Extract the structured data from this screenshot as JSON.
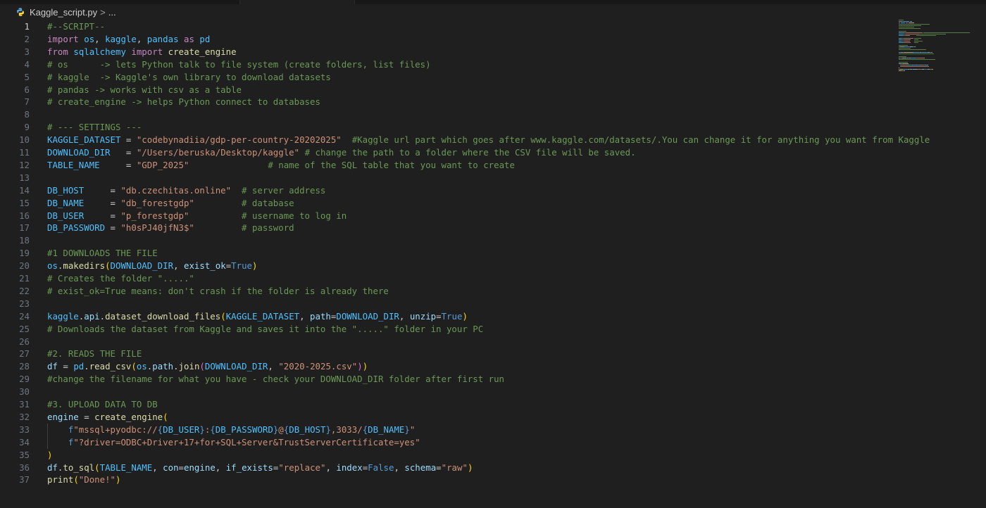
{
  "breadcrumb": {
    "file_name": "Kaggle_script.py",
    "chevron": ">",
    "ellipsis": "...",
    "file_icon": "python-icon"
  },
  "editor": {
    "current_line": 1,
    "lines": [
      {
        "n": "1",
        "tokens": [
          {
            "t": "#--SCRIPT--",
            "c": "c"
          }
        ]
      },
      {
        "n": "2",
        "tokens": [
          {
            "t": "import",
            "c": "k"
          },
          {
            "t": " "
          },
          {
            "t": "os",
            "c": "u"
          },
          {
            "t": ", "
          },
          {
            "t": "kaggle",
            "c": "u"
          },
          {
            "t": ", "
          },
          {
            "t": "pandas",
            "c": "u"
          },
          {
            "t": " "
          },
          {
            "t": "as",
            "c": "k"
          },
          {
            "t": " "
          },
          {
            "t": "pd",
            "c": "u"
          }
        ]
      },
      {
        "n": "3",
        "tokens": [
          {
            "t": "from",
            "c": "k"
          },
          {
            "t": " "
          },
          {
            "t": "sqlalchemy",
            "c": "u"
          },
          {
            "t": " "
          },
          {
            "t": "import",
            "c": "k"
          },
          {
            "t": " "
          },
          {
            "t": "create_engine",
            "c": "t"
          }
        ]
      },
      {
        "n": "4",
        "tokens": [
          {
            "t": "# os      -> lets Python talk to file system (create folders, list files)",
            "c": "c"
          }
        ]
      },
      {
        "n": "5",
        "tokens": [
          {
            "t": "# kaggle  -> Kaggle's own library to download datasets",
            "c": "c"
          }
        ]
      },
      {
        "n": "6",
        "tokens": [
          {
            "t": "# pandas -> works with csv as a table",
            "c": "c"
          }
        ]
      },
      {
        "n": "7",
        "tokens": [
          {
            "t": "# create_engine -> helps Python connect to databases",
            "c": "c"
          }
        ]
      },
      {
        "n": "8",
        "tokens": []
      },
      {
        "n": "9",
        "tokens": [
          {
            "t": "# --- SETTINGS ---",
            "c": "c"
          }
        ]
      },
      {
        "n": "10",
        "tokens": [
          {
            "t": "KAGGLE_DATASET",
            "c": "u"
          },
          {
            "t": " = "
          },
          {
            "t": "\"codebynadiia/gdp-per-country-20202025\"",
            "c": "s"
          },
          {
            "t": "  "
          },
          {
            "t": "#Kaggle url part which goes after www.kaggle.com/datasets/.You can change it for anything you want from Kaggle",
            "c": "c"
          }
        ]
      },
      {
        "n": "11",
        "tokens": [
          {
            "t": "DOWNLOAD_DIR",
            "c": "u"
          },
          {
            "t": "   = "
          },
          {
            "t": "\"/Users/beruska/Desktop/kaggle\"",
            "c": "s"
          },
          {
            "t": " "
          },
          {
            "t": "# change the path to a folder where the CSV file will be saved.",
            "c": "c"
          }
        ]
      },
      {
        "n": "12",
        "tokens": [
          {
            "t": "TABLE_NAME",
            "c": "u"
          },
          {
            "t": "     = "
          },
          {
            "t": "\"GDP_2025\"",
            "c": "s"
          },
          {
            "t": "               "
          },
          {
            "t": "# name of the SQL table that you want to create",
            "c": "c"
          }
        ]
      },
      {
        "n": "13",
        "tokens": []
      },
      {
        "n": "14",
        "tokens": [
          {
            "t": "DB_HOST",
            "c": "u"
          },
          {
            "t": "     = "
          },
          {
            "t": "\"db.czechitas.online\"",
            "c": "s"
          },
          {
            "t": "  "
          },
          {
            "t": "# server address",
            "c": "c"
          }
        ]
      },
      {
        "n": "15",
        "tokens": [
          {
            "t": "DB_NAME",
            "c": "u"
          },
          {
            "t": "     = "
          },
          {
            "t": "\"db_forestgdp\"",
            "c": "s"
          },
          {
            "t": "         "
          },
          {
            "t": "# database",
            "c": "c"
          }
        ]
      },
      {
        "n": "16",
        "tokens": [
          {
            "t": "DB_USER",
            "c": "u"
          },
          {
            "t": "     = "
          },
          {
            "t": "\"p_forestgdp\"",
            "c": "s"
          },
          {
            "t": "          "
          },
          {
            "t": "# username to log in",
            "c": "c"
          }
        ]
      },
      {
        "n": "17",
        "tokens": [
          {
            "t": "DB_PASSWORD",
            "c": "u"
          },
          {
            "t": " = "
          },
          {
            "t": "\"h0sPJ40jfN3$\"",
            "c": "s"
          },
          {
            "t": "         "
          },
          {
            "t": "# password",
            "c": "c"
          }
        ]
      },
      {
        "n": "18",
        "tokens": []
      },
      {
        "n": "19",
        "tokens": [
          {
            "t": "#1 DOWNLOADS THE FILE",
            "c": "c"
          }
        ]
      },
      {
        "n": "20",
        "tokens": [
          {
            "t": "os",
            "c": "u"
          },
          {
            "t": "."
          },
          {
            "t": "makedirs",
            "c": "t"
          },
          {
            "t": "(",
            "c": "y"
          },
          {
            "t": "DOWNLOAD_DIR",
            "c": "u"
          },
          {
            "t": ", "
          },
          {
            "t": "exist_ok",
            "c": "v"
          },
          {
            "t": "="
          },
          {
            "t": "True",
            "c": "bc"
          },
          {
            "t": ")",
            "c": "y"
          }
        ]
      },
      {
        "n": "21",
        "tokens": [
          {
            "t": "# Creates the folder \".....\"",
            "c": "c"
          }
        ]
      },
      {
        "n": "22",
        "tokens": [
          {
            "t": "# exist_ok=True means: don't crash if the folder is already there",
            "c": "c"
          }
        ]
      },
      {
        "n": "23",
        "tokens": []
      },
      {
        "n": "24",
        "tokens": [
          {
            "t": "kaggle",
            "c": "u"
          },
          {
            "t": "."
          },
          {
            "t": "api",
            "c": "v"
          },
          {
            "t": "."
          },
          {
            "t": "dataset_download_files",
            "c": "t"
          },
          {
            "t": "(",
            "c": "y"
          },
          {
            "t": "KAGGLE_DATASET",
            "c": "u"
          },
          {
            "t": ", "
          },
          {
            "t": "path",
            "c": "v"
          },
          {
            "t": "="
          },
          {
            "t": "DOWNLOAD_DIR",
            "c": "u"
          },
          {
            "t": ", "
          },
          {
            "t": "unzip",
            "c": "v"
          },
          {
            "t": "="
          },
          {
            "t": "True",
            "c": "bc"
          },
          {
            "t": ")",
            "c": "y"
          }
        ]
      },
      {
        "n": "25",
        "tokens": [
          {
            "t": "# Downloads the dataset from Kaggle and saves it into the \".....\" folder in your PC",
            "c": "c"
          }
        ]
      },
      {
        "n": "26",
        "tokens": []
      },
      {
        "n": "27",
        "tokens": [
          {
            "t": "#2. READS THE FILE",
            "c": "c"
          }
        ]
      },
      {
        "n": "28",
        "tokens": [
          {
            "t": "df",
            "c": "v"
          },
          {
            "t": " = "
          },
          {
            "t": "pd",
            "c": "u"
          },
          {
            "t": "."
          },
          {
            "t": "read_csv",
            "c": "t"
          },
          {
            "t": "(",
            "c": "y"
          },
          {
            "t": "os",
            "c": "u"
          },
          {
            "t": "."
          },
          {
            "t": "path",
            "c": "v"
          },
          {
            "t": "."
          },
          {
            "t": "join",
            "c": "t"
          },
          {
            "t": "(",
            "c": "m"
          },
          {
            "t": "DOWNLOAD_DIR",
            "c": "u"
          },
          {
            "t": ", "
          },
          {
            "t": "\"2020-2025.csv\"",
            "c": "s"
          },
          {
            "t": ")",
            "c": "m"
          },
          {
            "t": ")",
            "c": "y"
          }
        ]
      },
      {
        "n": "29",
        "tokens": [
          {
            "t": "#change the filename for what you have - check your DOWNLOAD_DIR folder after first run",
            "c": "c"
          }
        ]
      },
      {
        "n": "30",
        "tokens": []
      },
      {
        "n": "31",
        "tokens": [
          {
            "t": "#3. UPLOAD DATA TO DB",
            "c": "c"
          }
        ]
      },
      {
        "n": "32",
        "tokens": [
          {
            "t": "engine",
            "c": "v"
          },
          {
            "t": " = "
          },
          {
            "t": "create_engine",
            "c": "t"
          },
          {
            "t": "(",
            "c": "y"
          }
        ]
      },
      {
        "n": "33",
        "indent": true,
        "tokens": [
          {
            "t": "    "
          },
          {
            "t": "f",
            "c": "bc"
          },
          {
            "t": "\"mssql+pyodbc://",
            "c": "s"
          },
          {
            "t": "{",
            "c": "bc"
          },
          {
            "t": "DB_USER",
            "c": "u"
          },
          {
            "t": "}",
            "c": "bc"
          },
          {
            "t": ":",
            "c": "s"
          },
          {
            "t": "{",
            "c": "bc"
          },
          {
            "t": "DB_PASSWORD",
            "c": "u"
          },
          {
            "t": "}",
            "c": "bc"
          },
          {
            "t": "@",
            "c": "s"
          },
          {
            "t": "{",
            "c": "bc"
          },
          {
            "t": "DB_HOST",
            "c": "u"
          },
          {
            "t": "}",
            "c": "bc"
          },
          {
            "t": ",3033/",
            "c": "s"
          },
          {
            "t": "{",
            "c": "bc"
          },
          {
            "t": "DB_NAME",
            "c": "u"
          },
          {
            "t": "}",
            "c": "bc"
          },
          {
            "t": "\"",
            "c": "s"
          }
        ]
      },
      {
        "n": "34",
        "indent": true,
        "tokens": [
          {
            "t": "    "
          },
          {
            "t": "f",
            "c": "bc"
          },
          {
            "t": "\"?driver=ODBC+Driver+17+for+SQL+Server&TrustServerCertificate=yes\"",
            "c": "s"
          }
        ]
      },
      {
        "n": "35",
        "tokens": [
          {
            "t": ")",
            "c": "y"
          }
        ]
      },
      {
        "n": "36",
        "tokens": [
          {
            "t": "df",
            "c": "v"
          },
          {
            "t": "."
          },
          {
            "t": "to_sql",
            "c": "t"
          },
          {
            "t": "(",
            "c": "y"
          },
          {
            "t": "TABLE_NAME",
            "c": "u"
          },
          {
            "t": ", "
          },
          {
            "t": "con",
            "c": "v"
          },
          {
            "t": "="
          },
          {
            "t": "engine",
            "c": "v"
          },
          {
            "t": ", "
          },
          {
            "t": "if_exists",
            "c": "v"
          },
          {
            "t": "="
          },
          {
            "t": "\"replace\"",
            "c": "s"
          },
          {
            "t": ", "
          },
          {
            "t": "index",
            "c": "v"
          },
          {
            "t": "="
          },
          {
            "t": "False",
            "c": "bc"
          },
          {
            "t": ", "
          },
          {
            "t": "schema",
            "c": "v"
          },
          {
            "t": "="
          },
          {
            "t": "\"raw\"",
            "c": "s"
          },
          {
            "t": ")",
            "c": "y"
          }
        ]
      },
      {
        "n": "37",
        "tokens": [
          {
            "t": "print",
            "c": "t"
          },
          {
            "t": "(",
            "c": "y"
          },
          {
            "t": "\"Done!\"",
            "c": "s"
          },
          {
            "t": ")",
            "c": "y"
          }
        ]
      }
    ]
  },
  "colors": {
    "background": "#1f1f1f",
    "comment": "#6a9955",
    "keyword": "#c586c0",
    "function": "#dcdcaa",
    "string": "#ce9178",
    "variable": "#9cdcfe",
    "constant": "#4fc1ff",
    "builtin": "#569cd6"
  }
}
